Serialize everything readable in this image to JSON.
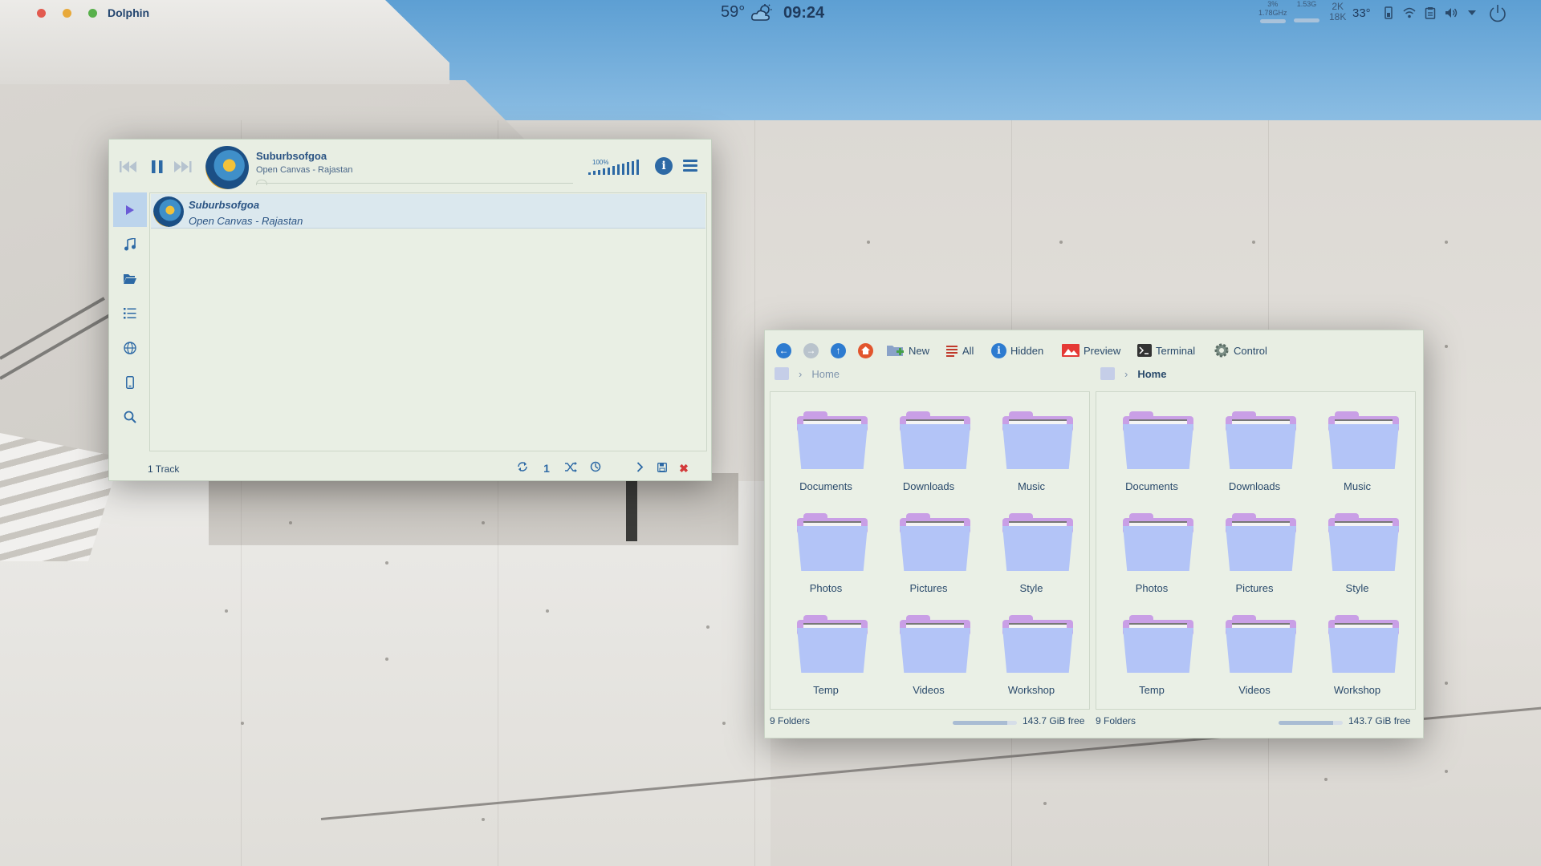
{
  "topbar": {
    "app_name": "Dolphin",
    "temperature": "59°",
    "time": "09:24",
    "cpu_percent": "3%",
    "cpu_freq": "1.78GHz",
    "mem": "1.53G",
    "net_up": "2K",
    "net_down": "18K",
    "cpu_temp": "33°"
  },
  "player": {
    "now_playing": {
      "title": "Suburbsofgoa",
      "subtitle": "Open Canvas - Rajastan"
    },
    "volume_label": "100%",
    "playlist": [
      {
        "title": "Suburbsofgoa",
        "subtitle": "Open Canvas - Rajastan"
      }
    ],
    "track_count": "1 Track",
    "footer_number": "1",
    "footer_close": "✖"
  },
  "filemanager": {
    "toolbar": {
      "new": "New",
      "all": "All",
      "hidden": "Hidden",
      "preview": "Preview",
      "terminal": "Terminal",
      "control": "Control"
    },
    "left_pane": {
      "breadcrumb": "Home",
      "folders": [
        "Documents",
        "Downloads",
        "Music",
        "Photos",
        "Pictures",
        "Style",
        "Temp",
        "Videos",
        "Workshop"
      ],
      "status": "9 Folders",
      "free": "143.7 GiB free",
      "free_fraction": 0.85
    },
    "right_pane": {
      "breadcrumb": "Home",
      "folders": [
        "Documents",
        "Downloads",
        "Music",
        "Photos",
        "Pictures",
        "Style",
        "Temp",
        "Videos",
        "Workshop"
      ],
      "status": "9 Folders",
      "free": "143.7 GiB free",
      "free_fraction": 0.85
    }
  },
  "colors": {
    "accent": "#2d69a5",
    "folder_front": "#b3c4f7",
    "folder_back": "#c99fe6",
    "window_bg": "#e8eee3"
  }
}
